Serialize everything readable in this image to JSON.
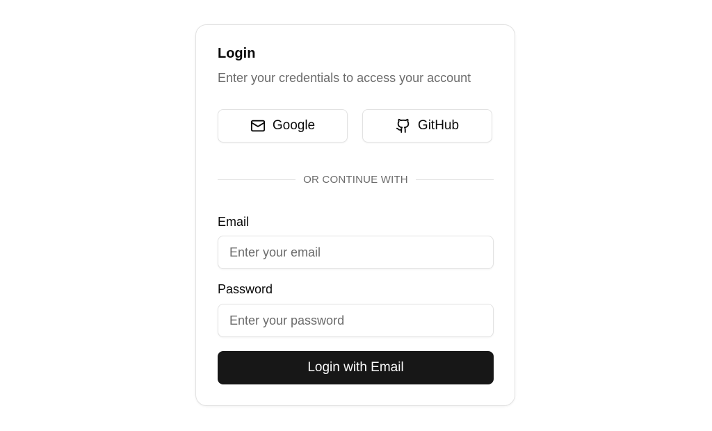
{
  "login": {
    "title": "Login",
    "subtitle": "Enter your credentials to access your account",
    "social": {
      "google": {
        "label": "Google",
        "icon": "mail-icon"
      },
      "github": {
        "label": "GitHub",
        "icon": "github-icon"
      }
    },
    "divider_text": "OR CONTINUE WITH",
    "email": {
      "label": "Email",
      "value": "",
      "placeholder": "Enter your email"
    },
    "password": {
      "label": "Password",
      "value": "",
      "placeholder": "Enter your password"
    },
    "submit_label": "Login with Email"
  },
  "colors": {
    "primary_button_bg": "#171717",
    "primary_button_text": "#fafafa",
    "border": "#e2e2e2",
    "muted_text": "#6b6b6b"
  }
}
